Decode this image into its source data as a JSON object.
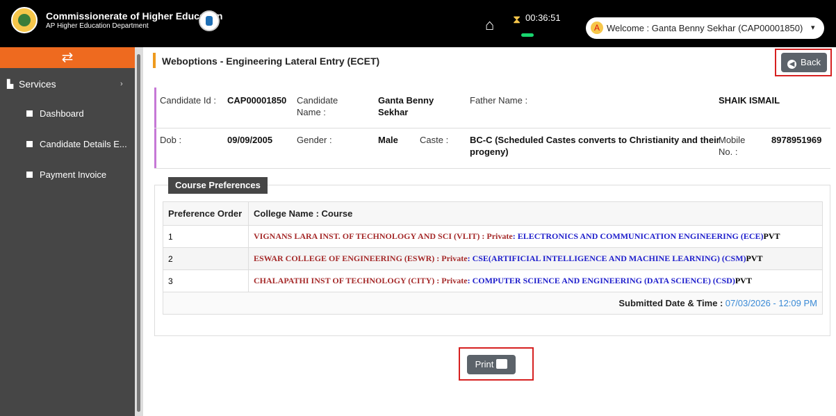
{
  "header": {
    "brand_title": "Commissionerate of Higher Education",
    "brand_subtitle": "AP Higher Education Department",
    "timer": "00:36:51",
    "user_avatar_letter": "A",
    "welcome": "Welcome : Ganta Benny Sekhar (CAP00001850)",
    "caret": "▾"
  },
  "sidebar": {
    "toggle_icon": "⇄",
    "services_label": "Services",
    "services_caret": "›",
    "items": [
      {
        "label": "Dashboard"
      },
      {
        "label": "Candidate Details E..."
      },
      {
        "label": "Payment Invoice"
      }
    ]
  },
  "main": {
    "page_title": "Weboptions - Engineering Lateral Entry (ECET)",
    "back_label": "Back",
    "candidate": {
      "id_label": "Candidate Id :",
      "id_value": "CAP00001850",
      "name_label": "Candidate Name :",
      "name_value": "Ganta Benny Sekhar",
      "father_label": "Father Name :",
      "father_value": "SHAIK ISMAIL",
      "dob_label": "Dob :",
      "dob_value": "09/09/2005",
      "gender_label": "Gender :",
      "gender_value": "Male",
      "caste_label": "Caste :",
      "caste_value": "BC-C (Scheduled Castes converts to Christianity and their progeny)",
      "mobile_label": "Mobile No. :",
      "mobile_value": "8978951969"
    },
    "preferences": {
      "legend": "Course Preferences",
      "columns": [
        "Preference Order",
        "College Name : Course"
      ],
      "rows": [
        {
          "order": "1",
          "college": "VIGNANS LARA INST. OF TECHNOLOGY AND SCI (VLIT) : Private",
          "course": ": ELECTRONICS AND COMMUNICATION ENGINEERING (ECE)",
          "type": "PVT"
        },
        {
          "order": "2",
          "college": "ESWAR COLLEGE OF ENGINEERING (ESWR) : Private",
          "course": ": CSE(ARTIFICIAL INTELLIGENCE AND MACHINE LEARNING) (CSM)",
          "type": "PVT"
        },
        {
          "order": "3",
          "college": "CHALAPATHI INST OF TECHNOLOGY (CITY) : Private",
          "course": ": COMPUTER SCIENCE AND ENGINEERING (DATA SCIENCE) (CSD)",
          "type": "PVT"
        }
      ],
      "submitted_label": "Submitted Date & Time :",
      "submitted_value": "07/03/2026 - 12:09 PM"
    },
    "print_label": "Print"
  },
  "colors": {
    "topbar": "#000000",
    "sidebar": "#464646",
    "accent_orange": "#ee6a1f",
    "button_gray": "#5c636a",
    "highlight_red": "#d62020"
  },
  "icons": {
    "home": "home-icon",
    "timer": "hourglass-icon",
    "back": "arrow-left-circle-icon",
    "print": "printer-icon"
  }
}
